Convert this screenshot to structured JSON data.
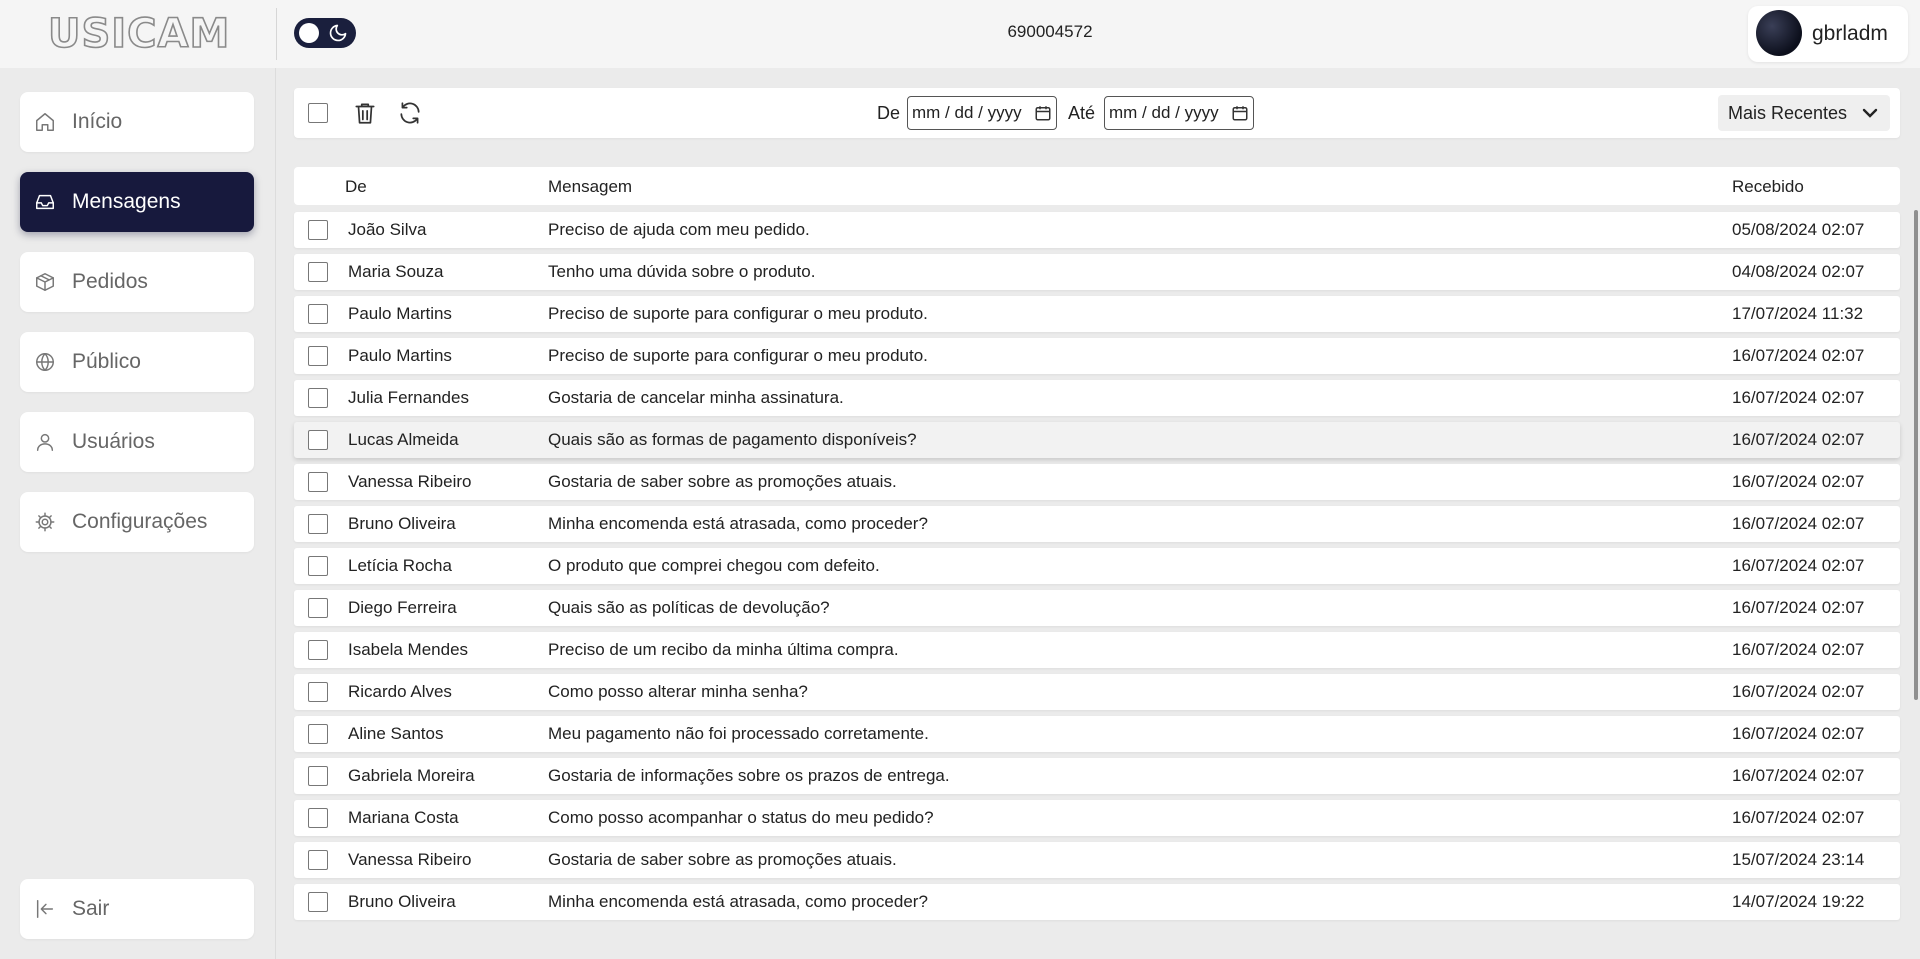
{
  "brand": {
    "logo_text": "USICAM"
  },
  "header": {
    "center_id": "690004572",
    "username": "gbrladm"
  },
  "sidebar": {
    "items": [
      {
        "label": "Início",
        "icon": "home-icon",
        "active": false
      },
      {
        "label": "Mensagens",
        "icon": "inbox-icon",
        "active": true
      },
      {
        "label": "Pedidos",
        "icon": "package-icon",
        "active": false
      },
      {
        "label": "Público",
        "icon": "globe-icon",
        "active": false
      },
      {
        "label": "Usuários",
        "icon": "user-icon",
        "active": false
      },
      {
        "label": "Configurações",
        "icon": "gear-icon",
        "active": false
      }
    ],
    "logout_label": "Sair"
  },
  "toolbar": {
    "from_label": "De",
    "to_label": "Até",
    "date_placeholder": "mm / dd / yyyy",
    "sort_label": "Mais Recentes"
  },
  "table": {
    "columns": {
      "from": "De",
      "message": "Mensagem",
      "received": "Recebido"
    },
    "rows": [
      {
        "from": "João Silva",
        "message": "Preciso de ajuda com meu pedido.",
        "received": "05/08/2024 02:07"
      },
      {
        "from": "Maria Souza",
        "message": "Tenho uma dúvida sobre o produto.",
        "received": "04/08/2024 02:07"
      },
      {
        "from": "Paulo Martins",
        "message": "Preciso de suporte para configurar o meu produto.",
        "received": "17/07/2024 11:32"
      },
      {
        "from": "Paulo Martins",
        "message": "Preciso de suporte para configurar o meu produto.",
        "received": "16/07/2024 02:07"
      },
      {
        "from": "Julia Fernandes",
        "message": "Gostaria de cancelar minha assinatura.",
        "received": "16/07/2024 02:07"
      },
      {
        "from": "Lucas Almeida",
        "message": "Quais são as formas de pagamento disponíveis?",
        "received": "16/07/2024 02:07"
      },
      {
        "from": "Vanessa Ribeiro",
        "message": "Gostaria de saber sobre as promoções atuais.",
        "received": "16/07/2024 02:07"
      },
      {
        "from": "Bruno Oliveira",
        "message": "Minha encomenda está atrasada, como proceder?",
        "received": "16/07/2024 02:07"
      },
      {
        "from": "Letícia Rocha",
        "message": "O produto que comprei chegou com defeito.",
        "received": "16/07/2024 02:07"
      },
      {
        "from": "Diego Ferreira",
        "message": "Quais são as políticas de devolução?",
        "received": "16/07/2024 02:07"
      },
      {
        "from": "Isabela Mendes",
        "message": "Preciso de um recibo da minha última compra.",
        "received": "16/07/2024 02:07"
      },
      {
        "from": "Ricardo Alves",
        "message": "Como posso alterar minha senha?",
        "received": "16/07/2024 02:07"
      },
      {
        "from": "Aline Santos",
        "message": "Meu pagamento não foi processado corretamente.",
        "received": "16/07/2024 02:07"
      },
      {
        "from": "Gabriela Moreira",
        "message": "Gostaria de informações sobre os prazos de entrega.",
        "received": "16/07/2024 02:07"
      },
      {
        "from": "Mariana Costa",
        "message": "Como posso acompanhar o status do meu pedido?",
        "received": "16/07/2024 02:07"
      },
      {
        "from": "Vanessa Ribeiro",
        "message": "Gostaria de saber sobre as promoções atuais.",
        "received": "15/07/2024 23:14"
      },
      {
        "from": "Bruno Oliveira",
        "message": "Minha encomenda está atrasada, como proceder?",
        "received": "14/07/2024 19:22"
      }
    ]
  },
  "colors": {
    "accent": "#17193d",
    "background": "#ebebeb",
    "surface": "#ffffff"
  }
}
